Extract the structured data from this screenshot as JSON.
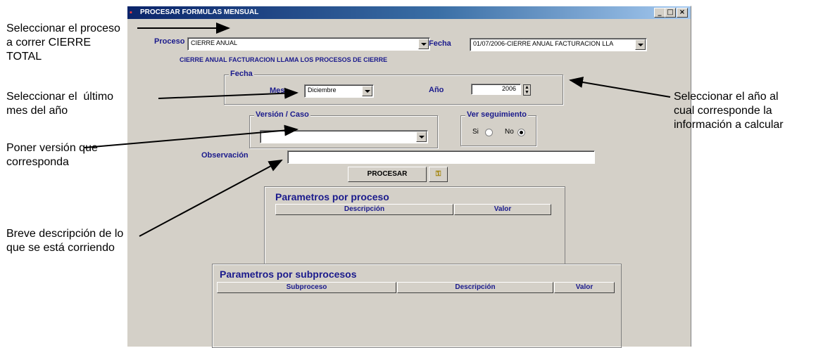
{
  "window": {
    "title": "PROCESAR FORMULAS MENSUAL",
    "min_glyph": "_",
    "max_glyph": "□",
    "close_glyph": "×"
  },
  "form": {
    "proceso_label": "Proceso",
    "proceso_value": "CIERRE ANUAL",
    "fecha_label": "Fecha",
    "fecha_value": "01/07/2006-CIERRE ANUAL FACTURACION LLA",
    "description": "CIERRE ANUAL FACTURACION LLAMA LOS PROCESOS DE CIERRE",
    "fecha_group_title": "Fecha",
    "mes_label": "Mes",
    "mes_value": "Diciembre",
    "anio_label": "Año",
    "anio_value": "2006",
    "version_group_title": "Versión / Caso",
    "version_value": "",
    "seguimiento_group_title": "Ver seguimiento",
    "si_label": "Si",
    "no_label": "No",
    "seguimiento_selected": "No",
    "observacion_label": "Observación",
    "observacion_value": "",
    "procesar_label": "PROCESAR"
  },
  "param_proceso": {
    "title": "Parametros por proceso",
    "columns": [
      "Descripción",
      "Valor"
    ]
  },
  "param_subprocesos": {
    "title": "Parametros por subprocesos",
    "columns": [
      "Subproceso",
      "Descripción",
      "Valor"
    ]
  },
  "annotations": [
    "Seleccionar el proceso\na correr CIERRE\nTOTAL",
    "Seleccionar el  último\nmes del año",
    "Poner versión que\ncorresponda",
    "Breve descripción de lo\nque se está corriendo",
    "Seleccionar el año al\ncual corresponde la\ninformación a calcular"
  ],
  "colors": {
    "dialog_bg": "#d4d0c8",
    "label_blue": "#1a1a8c",
    "title_bar": "#0a246a"
  }
}
